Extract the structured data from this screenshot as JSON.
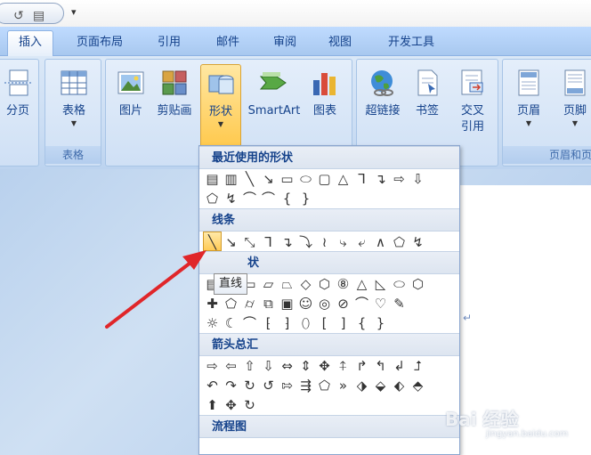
{
  "qat": {
    "undo_icon": "undo-icon",
    "view_icon": "layout-icon",
    "drop": "▾"
  },
  "tabs": [
    "插入",
    "页面布局",
    "引用",
    "邮件",
    "审阅",
    "视图",
    "开发工具"
  ],
  "ribbon": {
    "page_break": "分页",
    "table": "表格",
    "table_group": "表格",
    "picture": "图片",
    "clipart": "剪贴画",
    "shapes": "形状",
    "smartart": "SmartArt",
    "chart": "图表",
    "hyperlink": "超链接",
    "bookmark": "书签",
    "crossref_1": "交叉",
    "crossref_2": "引用",
    "header": "页眉",
    "footer": "页脚",
    "header_footer_group": "页眉和页"
  },
  "gallery": {
    "recent": "最近使用的形状",
    "lines": "线条",
    "basic": "状",
    "arrows": "箭头总汇",
    "flowchart": "流程图",
    "recent_row1": [
      "▤",
      "▥",
      "╲",
      "↘",
      "▭",
      "⬭",
      "▢",
      "△",
      "⅂",
      "↴",
      "⇨",
      "⇩"
    ],
    "recent_row2": [
      "⬠",
      "↯",
      "⌒",
      "⌒",
      "{",
      "}"
    ],
    "lines_row": [
      "╲",
      "↘",
      "⤡",
      "⅂",
      "↴",
      "⤵",
      "≀",
      "⤷",
      "⤶",
      "∧",
      "⬠",
      "↯"
    ],
    "basic_row1": [
      "▤",
      "▥",
      "▭",
      "▱",
      "⏢",
      "◇",
      "⬡",
      "⑧",
      "△",
      "◺",
      "⬭",
      "⬡"
    ],
    "basic_row2": [
      "✚",
      "⬠",
      "⌭",
      "⧉",
      "▣",
      "☺",
      "◎",
      "⊘",
      "⌒",
      "♡",
      "✎"
    ],
    "basic_row3": [
      "☼",
      "☾",
      "⌒",
      "⁅",
      "⁆",
      "⬯",
      "[",
      "]",
      "{",
      "}"
    ],
    "arrow_row1": [
      "⇨",
      "⇦",
      "⇧",
      "⇩",
      "⇔",
      "⇕",
      "✥",
      "⍏",
      "↱",
      "↰",
      "↲",
      "⮥"
    ],
    "arrow_row2": [
      "↶",
      "↷",
      "↻",
      "↺",
      "⇰",
      "⇶",
      "⬠",
      "»",
      "⬗",
      "⬙",
      "⬖",
      "⬘"
    ],
    "arrow_row3": [
      "⬆",
      "✥",
      "↻"
    ]
  },
  "tooltip": "直线",
  "watermark": "Bai 经验",
  "watermark_sub": "jingyan.baidu.com",
  "para_mark": "↵"
}
